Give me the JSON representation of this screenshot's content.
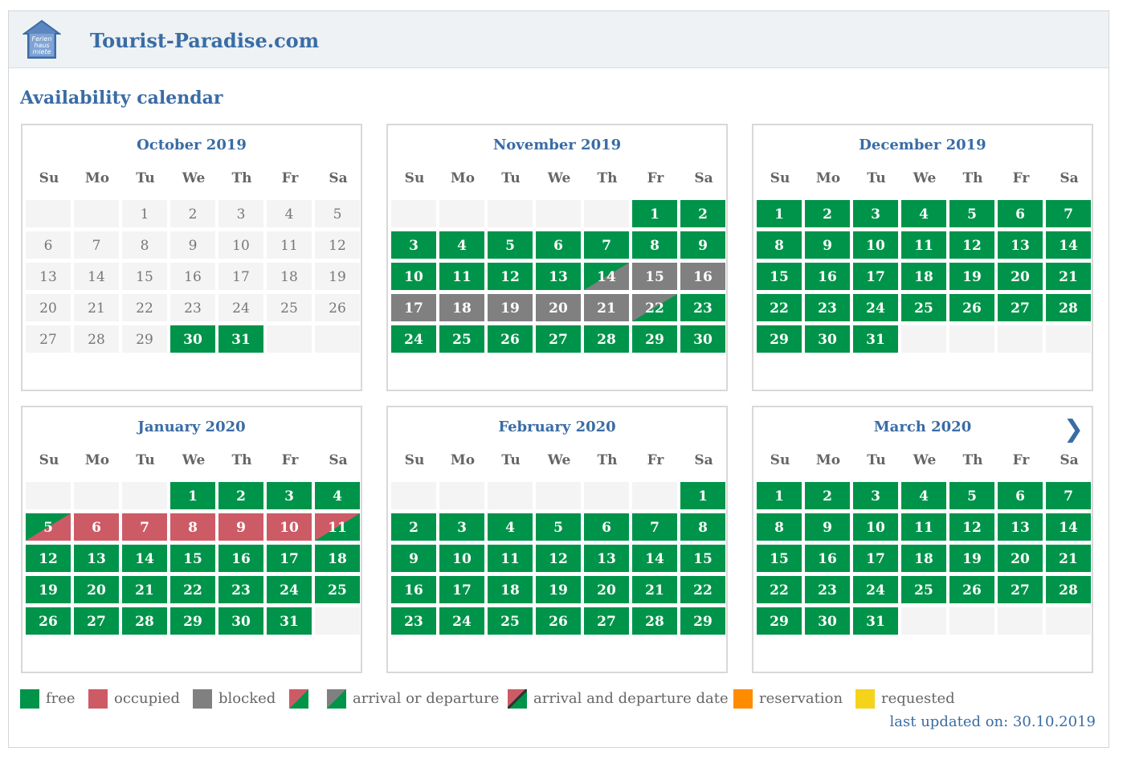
{
  "header": {
    "site_title": "Tourist-Paradise.com",
    "logo_text": "Ferienhausmiete"
  },
  "page_title": "Availability calendar",
  "weekdays": [
    "Su",
    "Mo",
    "Tu",
    "We",
    "Th",
    "Fr",
    "Sa"
  ],
  "next_icon": "❯",
  "months": [
    {
      "title": "October 2019",
      "first_weekday": 2,
      "num_days": 31,
      "states": {
        "1": "past",
        "2": "past",
        "3": "past",
        "4": "past",
        "5": "past",
        "6": "past",
        "7": "past",
        "8": "past",
        "9": "past",
        "10": "past",
        "11": "past",
        "12": "past",
        "13": "past",
        "14": "past",
        "15": "past",
        "16": "past",
        "17": "past",
        "18": "past",
        "19": "past",
        "20": "past",
        "21": "past",
        "22": "past",
        "23": "past",
        "24": "past",
        "25": "past",
        "26": "past",
        "27": "past",
        "28": "past",
        "29": "past",
        "30": "free",
        "31": "free"
      },
      "trailing_blanks": 2
    },
    {
      "title": "November 2019",
      "first_weekday": 5,
      "num_days": 30,
      "states": {
        "14": "blk-arr",
        "15": "blk",
        "16": "blk",
        "17": "blk",
        "18": "blk",
        "19": "blk",
        "20": "blk",
        "21": "blk",
        "22": "blk-dep"
      },
      "trailing_blanks": 0
    },
    {
      "title": "December 2019",
      "first_weekday": 0,
      "num_days": 31,
      "states": {},
      "trailing_blanks": 4
    },
    {
      "title": "January 2020",
      "first_weekday": 3,
      "num_days": 31,
      "states": {
        "5": "occ-arr",
        "6": "occ",
        "7": "occ",
        "8": "occ",
        "9": "occ",
        "10": "occ",
        "11": "occ-dep"
      },
      "trailing_blanks": 1
    },
    {
      "title": "February 2020",
      "first_weekday": 6,
      "num_days": 29,
      "states": {},
      "trailing_blanks": 0
    },
    {
      "title": "March 2020",
      "first_weekday": 0,
      "num_days": 31,
      "states": {},
      "trailing_blanks": 4,
      "has_next": true
    }
  ],
  "legend": [
    {
      "swatch": "free",
      "label": "free"
    },
    {
      "swatch": "occ",
      "label": "occupied"
    },
    {
      "swatch": "blk",
      "label": "blocked"
    },
    {
      "swatch": "red-green",
      "label": ""
    },
    {
      "swatch": "gray-green",
      "label": "arrival or departure"
    },
    {
      "swatch": "red-green-line",
      "label": "arrival and departure date"
    },
    {
      "swatch": "res",
      "label": "reservation"
    },
    {
      "swatch": "req",
      "label": "requested"
    }
  ],
  "last_updated": "last updated on: 30.10.2019"
}
